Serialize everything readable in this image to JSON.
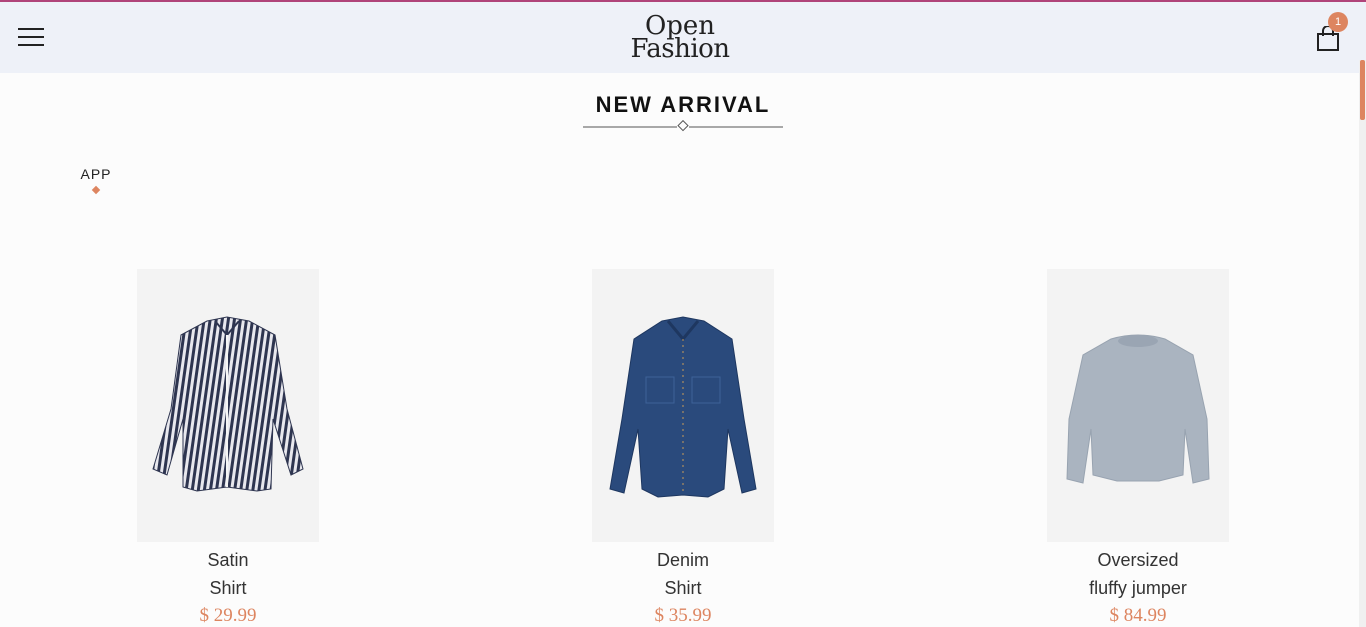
{
  "header": {
    "logo_line1": "Open",
    "logo_line2": "Fashion",
    "cart_count": "1"
  },
  "section": {
    "title": "NEW ARRIVAL"
  },
  "tabs": [
    {
      "label": "APP",
      "active": true
    }
  ],
  "products": [
    {
      "name_line1": "Satin",
      "name_line2": "Shirt",
      "price": "$ 29.99",
      "icon": "striped-shirt-image"
    },
    {
      "name_line1": "Denim",
      "name_line2": "Shirt",
      "price": "$ 35.99",
      "icon": "denim-shirt-image"
    },
    {
      "name_line1": "Oversized",
      "name_line2": "fluffy jumper",
      "price": "$ 84.99",
      "icon": "jumper-image"
    }
  ],
  "colors": {
    "accent": "#dd8560",
    "header_bg": "#eef1f8",
    "top_line": "#b0447a"
  }
}
